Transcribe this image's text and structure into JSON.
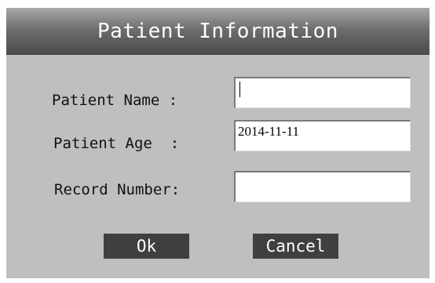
{
  "dialog": {
    "title": "Patient Information",
    "fields": [
      {
        "label": "Patient Name :",
        "value": ""
      },
      {
        "label": "Patient Age  :",
        "value": "2014-11-11"
      },
      {
        "label": "Record Number:",
        "value": ""
      }
    ],
    "buttons": {
      "ok_label": "Ok",
      "cancel_label": "Cancel"
    }
  },
  "colors": {
    "dialog_background": "#bfbfbf",
    "title_text": "#ffffff",
    "button_background": "#3f3f3f",
    "button_text": "#ffffff",
    "field_background": "#ffffff"
  }
}
